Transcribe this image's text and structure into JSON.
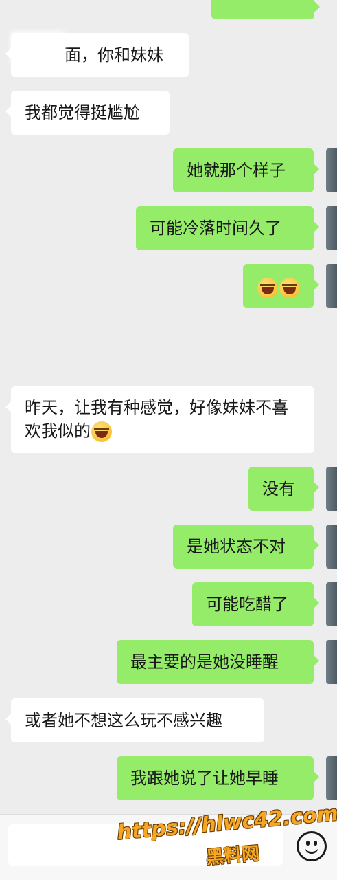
{
  "messages": [
    {
      "id": "m0",
      "side": "right",
      "text": ""
    },
    {
      "id": "m1",
      "side": "left",
      "text": "面，你和妹妹"
    },
    {
      "id": "m2",
      "side": "left",
      "text": "我都觉得挺尴尬"
    },
    {
      "id": "m3",
      "side": "right",
      "text": "她就那个样子"
    },
    {
      "id": "m4",
      "side": "right",
      "text": "可能冷落时间久了"
    },
    {
      "id": "m5",
      "side": "right",
      "emoji": [
        "tears-of-joy-emoji",
        "tears-of-joy-emoji"
      ]
    },
    {
      "id": "m6",
      "side": "left",
      "text": "昨天，让我有种感觉，好像妹妹不喜欢我似的",
      "emoji": [
        "facepalm-laugh-emoji"
      ]
    },
    {
      "id": "m7",
      "side": "right",
      "text": "没有"
    },
    {
      "id": "m8",
      "side": "right",
      "text": "是她状态不对"
    },
    {
      "id": "m9",
      "side": "right",
      "text": "可能吃醋了"
    },
    {
      "id": "m10",
      "side": "right",
      "text": "最主要的是她没睡醒"
    },
    {
      "id": "m11",
      "side": "left",
      "text": "或者她不想这么玩不感兴趣"
    },
    {
      "id": "m12",
      "side": "right",
      "text": "我跟她说了让她早睡"
    }
  ],
  "colors": {
    "background": "#ededed",
    "bubble_left": "#ffffff",
    "bubble_right": "#95ec69",
    "text": "#191919"
  },
  "input_bar": {
    "value": "",
    "emoji_button_icon": "smiley-icon"
  },
  "watermark": {
    "url": "https://hlwc42.com",
    "brand": "黑料网"
  }
}
